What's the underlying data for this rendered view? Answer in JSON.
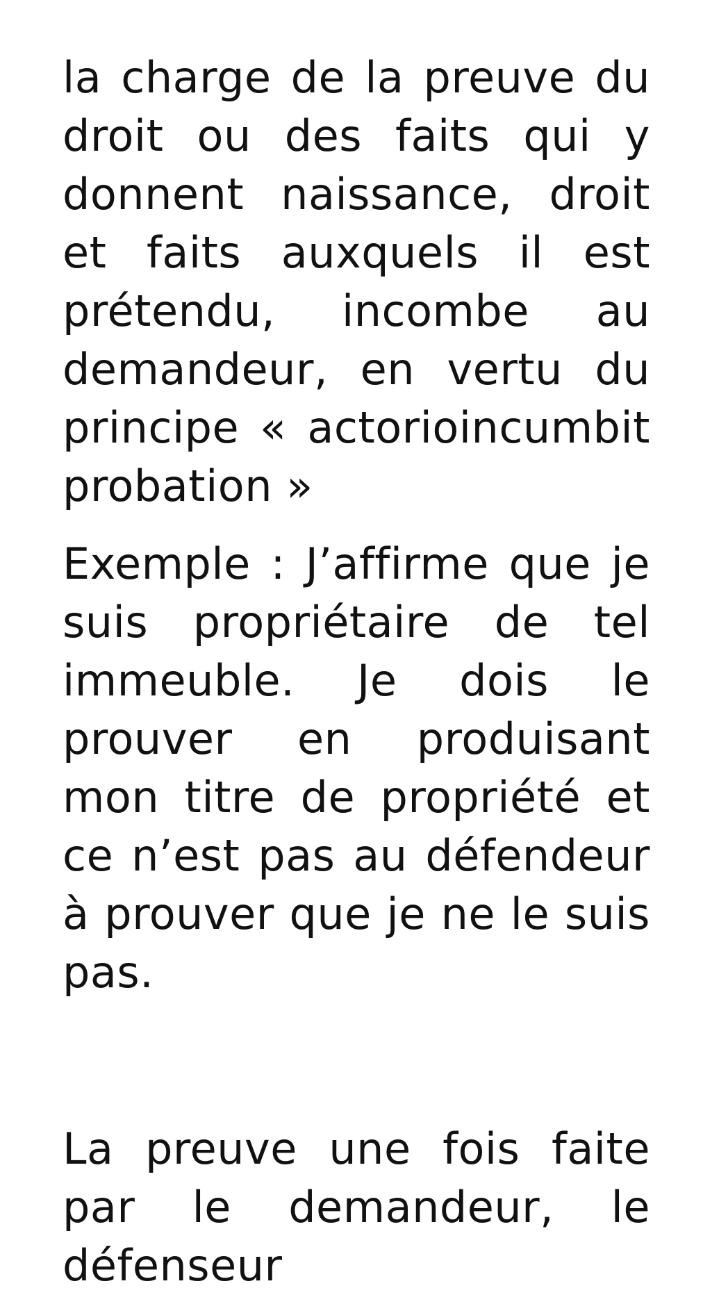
{
  "document": {
    "paragraphs": [
      "la charge de la preuve du droit ou des faits qui y donnent naissance, droit et faits auxquels il est prétendu, incombe au demandeur, en vertu du principe « actorioincumbit probation »",
      "Exemple : J’affirme que je suis propriétaire de tel immeuble. Je dois le prouver en produisant mon titre de propriété et ce n’est pas au défendeur à prouver que je ne le suis pas.",
      "La preuve une fois faite par le demandeur, le défenseur"
    ]
  }
}
